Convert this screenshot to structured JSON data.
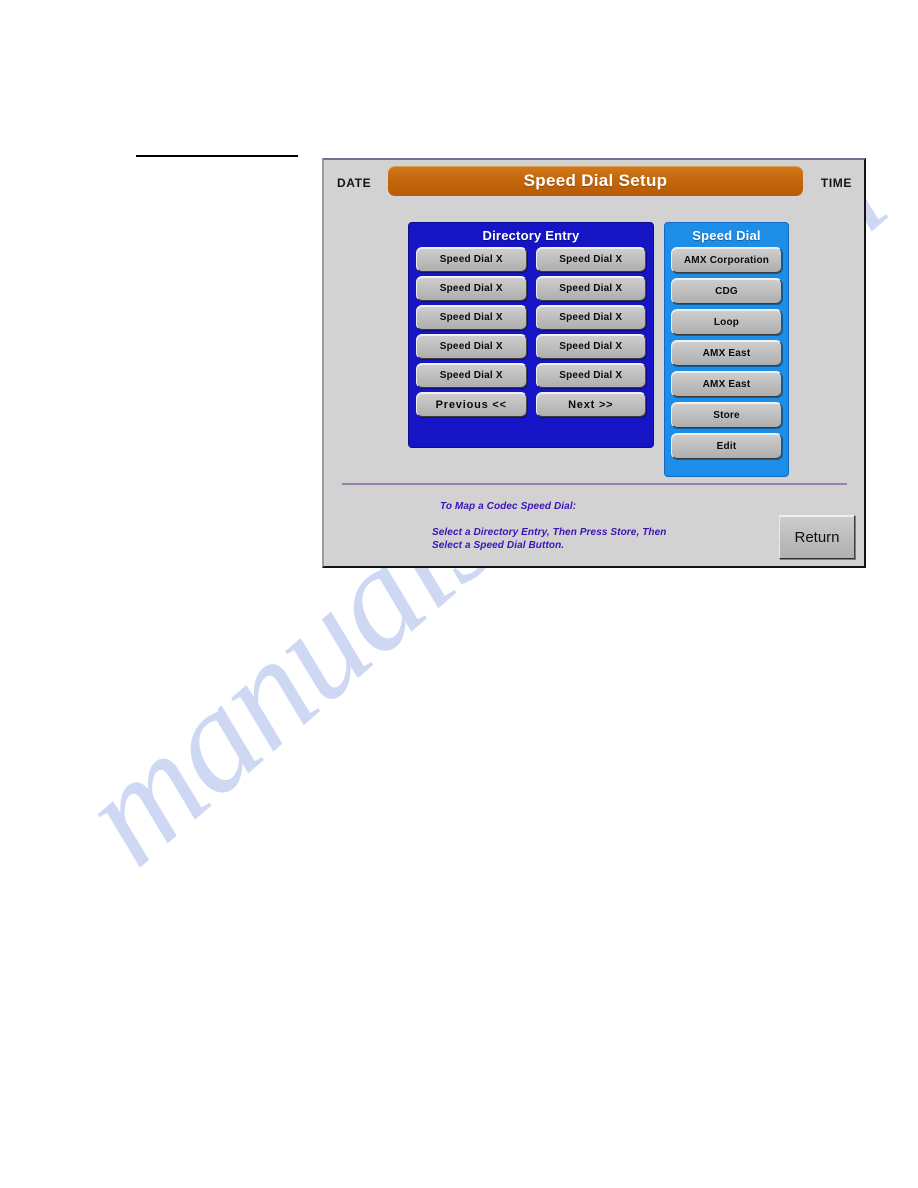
{
  "page": {
    "watermark": "manualshive.com"
  },
  "panel": {
    "header": {
      "date_label": "DATE",
      "time_label": "TIME",
      "title": "Speed Dial Setup"
    },
    "directory_entry": {
      "title": "Directory Entry",
      "buttons": [
        {
          "label": "Speed Dial X"
        },
        {
          "label": "Speed Dial X"
        },
        {
          "label": "Speed Dial X"
        },
        {
          "label": "Speed Dial X"
        },
        {
          "label": "Speed Dial X"
        },
        {
          "label": "Speed Dial X"
        },
        {
          "label": "Speed Dial X"
        },
        {
          "label": "Speed Dial X"
        },
        {
          "label": "Speed Dial X"
        },
        {
          "label": "Speed Dial X"
        }
      ],
      "previous_label": "Previous  <<",
      "next_label": "Next  >>"
    },
    "speed_dial": {
      "title": "Speed Dial",
      "buttons": [
        {
          "label": "AMX Corporation"
        },
        {
          "label": "CDG"
        },
        {
          "label": "Loop"
        },
        {
          "label": "AMX East"
        },
        {
          "label": "AMX East"
        },
        {
          "label": "Store"
        },
        {
          "label": "Edit"
        }
      ]
    },
    "footer": {
      "heading": "To Map a Codec Speed Dial:",
      "line1": "Select a Directory Entry, Then Press Store, Then",
      "line2": "Select a Speed Dial Button.",
      "return_label": "Return"
    },
    "colors": {
      "title_bar": "#c4670c",
      "directory_panel": "#1515c6",
      "speed_dial_panel": "#1d8ee8",
      "panel_background": "#d2d2d2",
      "footer_text": "#3b12b8",
      "divider": "#9b7fab"
    }
  }
}
